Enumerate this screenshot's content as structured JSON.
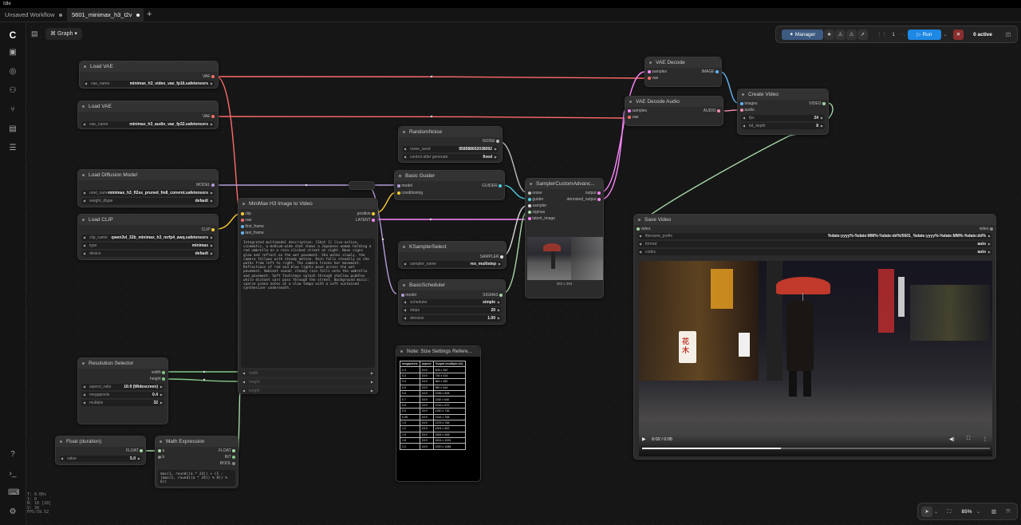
{
  "app": {
    "status": "Idle"
  },
  "tabs": [
    {
      "label": "Unsaved Workflow",
      "active": false
    },
    {
      "label": "5601_minimax_h3_t2v",
      "active": true
    }
  ],
  "toolbar": {
    "graph_label": "Graph",
    "manager_label": "Manager",
    "run_count": "1",
    "run_label": "Run",
    "active_label": "0 active"
  },
  "zoom": "85%",
  "stats": [
    "T: 0.00s",
    "I: 0",
    "N: 18 [18]",
    "V: 39",
    "FPS:59.52"
  ],
  "nodes": {
    "load_vae_1": {
      "title": "Load VAE",
      "out": "VAE",
      "w_label": "vae_name",
      "w_value": "minimax_h3_video_vae_fp16.safetensors"
    },
    "load_vae_2": {
      "title": "Load VAE",
      "out": "VAE",
      "w_label": "vae_name",
      "w_value": "minimax_h3_audio_vae_fp32.safetensors"
    },
    "load_diffusion": {
      "title": "Load Diffusion Model",
      "out": "MODEL",
      "w1_label": "unet_name",
      "w1_value": "minimax_h3_fl2ss_pruned_fm8_convrot.safetensors",
      "w2_label": "weight_dtype",
      "w2_value": "default"
    },
    "load_clip": {
      "title": "Load CLIP",
      "out": "CLIP",
      "w1_label": "clip_name",
      "w1_value": "qwen3vl_32b_minimax_h3_mrfp4_awq.safetensors",
      "w2_label": "type",
      "w2_value": "minimax",
      "w3_label": "device",
      "w3_value": "default"
    },
    "minimax": {
      "title": "MiniMax H3 Image to Video",
      "in": [
        "clip",
        "vae",
        "first_frame",
        "last_frame"
      ],
      "out": [
        "positive",
        "LATENT"
      ],
      "prompt": "Integrated multimodal description: [Shot 1] live-action, cinematic, a medium-wide shot shows a Japanese woman holding a red umbrella on a rain-slicked street at night. Neon signs glow and reflect on the wet pavement. She walks slowly, the camera follows with steady motion. Rain falls steadily as she walks from left to right. The camera tracks her movement. Reflections of red and blue lights move across the wet pavement. Ambient sound: steady rain falls onto the umbrella and pavement. Soft footsteps splash through shallow puddles while distant cars pass through the street. Background music: sparse piano notes at a slow tempo with a soft sustained synthesizer underneath.",
      "dis": [
        "width",
        "height",
        "length"
      ]
    },
    "resolution": {
      "title": "Resolution Selector",
      "out": [
        "width",
        "height"
      ],
      "w1_label": "aspect_ratio",
      "w1_value": "16:9 (Widescreen)",
      "w2_label": "megapixels",
      "w2_value": "0.4",
      "w3_label": "multiple",
      "w3_value": "32"
    },
    "float_duration": {
      "title": "Float (duration)",
      "out": "FLOAT",
      "w_label": "value",
      "w_value": "5.0"
    },
    "math": {
      "title": "Math Expression",
      "in": [
        "a",
        "b"
      ],
      "out": [
        "FLOAT",
        "INT",
        "BOOL"
      ],
      "expr": "max(1, round((a * 24)) + (1 - (max(1, round((a * 24)) % 8)) % 8))"
    },
    "random_noise": {
      "title": "RandomNoise",
      "out": "NOISE",
      "w1_label": "noise_seed",
      "w1_value": "958588602038092",
      "w2_label": "control after generate",
      "w2_value": "fixed"
    },
    "basic_guider": {
      "title": "Basic Guider",
      "in": [
        "model",
        "conditioning"
      ],
      "out": "GUIDER"
    },
    "ksampler_select": {
      "title": "KSamplerSelect",
      "out": "SAMPLER",
      "w_label": "sampler_name",
      "w_value": "res_multistep"
    },
    "basic_scheduler": {
      "title": "BasicScheduler",
      "in": [
        "model"
      ],
      "out": "SIGMAS",
      "w1_label": "scheduler",
      "w1_value": "simple",
      "w2_label": "steps",
      "w2_value": "20",
      "w3_label": "denoise",
      "w3_value": "1.00"
    },
    "sampler_custom": {
      "title": "SamplerCustomAdvanc...",
      "in": [
        "noise",
        "guider",
        "sampler",
        "sigmas",
        "latent_image"
      ],
      "out": [
        "output",
        "denoised_output"
      ],
      "dims": "352 x 384"
    },
    "vae_decode": {
      "title": "VAE Decode",
      "in": [
        "samples",
        "vae"
      ],
      "out": "IMAGE"
    },
    "vae_decode_audio": {
      "title": "VAE Decode Audio",
      "in": [
        "samples",
        "vae"
      ],
      "out": "AUDIO"
    },
    "create_video": {
      "title": "Create Video",
      "in": [
        "images",
        "audio"
      ],
      "out": "VIDEO",
      "w1_label": "fps",
      "w1_value": "24",
      "w2_label": "bit_depth",
      "w2_value": "8"
    },
    "save_video": {
      "title": "Save Video",
      "in": [
        "video"
      ],
      "out": "video",
      "w1_label": "filename_prefix",
      "w1_value": "%date:yyyy%-%date:MM%-%date:dd%/5601_%date:yyyy%-%date:MM%-%date:dd%",
      "w2_label": "format",
      "w2_value": "auto",
      "w3_label": "codec",
      "w3_value": "auto",
      "time": "0:02 / 0:05",
      "progress": 0.4
    },
    "note": {
      "title": "Note: Size Settings Refere...",
      "headers": [
        "megapixels",
        "Aspect",
        "Output (multiple=32)"
      ],
      "rows": [
        [
          "0.3",
          "16:9",
          "608 x 352"
        ],
        [
          "0.3",
          "16:9",
          "736 x 416"
        ],
        [
          "0.4",
          "16:9",
          "864 x 480"
        ],
        [
          "0.5",
          "16:9",
          "960 x 544"
        ],
        [
          "0.6",
          "16:9",
          "1056 x 608"
        ],
        [
          "0.7",
          "16:9",
          "1152 x 640"
        ],
        [
          "0.8",
          "16:9",
          "1216 x 672"
        ],
        [
          "0.9",
          "16:9",
          "1280 x 736"
        ],
        [
          "0.95",
          "16:9",
          "1344 x 768"
        ],
        [
          "1.0",
          "16:9",
          "1376 x 768"
        ],
        [
          "1.2",
          "16:9",
          "1504 x 832"
        ],
        [
          "1.5",
          "16:9",
          "1664 x 928"
        ],
        [
          "1.8",
          "16:9",
          "1824 x 1024"
        ],
        [
          "2.0",
          "16:9",
          "1920 x 1088"
        ]
      ]
    }
  },
  "colors": {
    "vae": "#ff6b6b",
    "model": "#b39ddb",
    "clip": "#ffcc33",
    "latent": "#ff88ff",
    "image": "#64b5f6",
    "audio": "#f48fb1",
    "video": "#a5d6a7",
    "guider": "#4dd0e1",
    "int": "#81c784",
    "noise": "#bbbbbb"
  }
}
